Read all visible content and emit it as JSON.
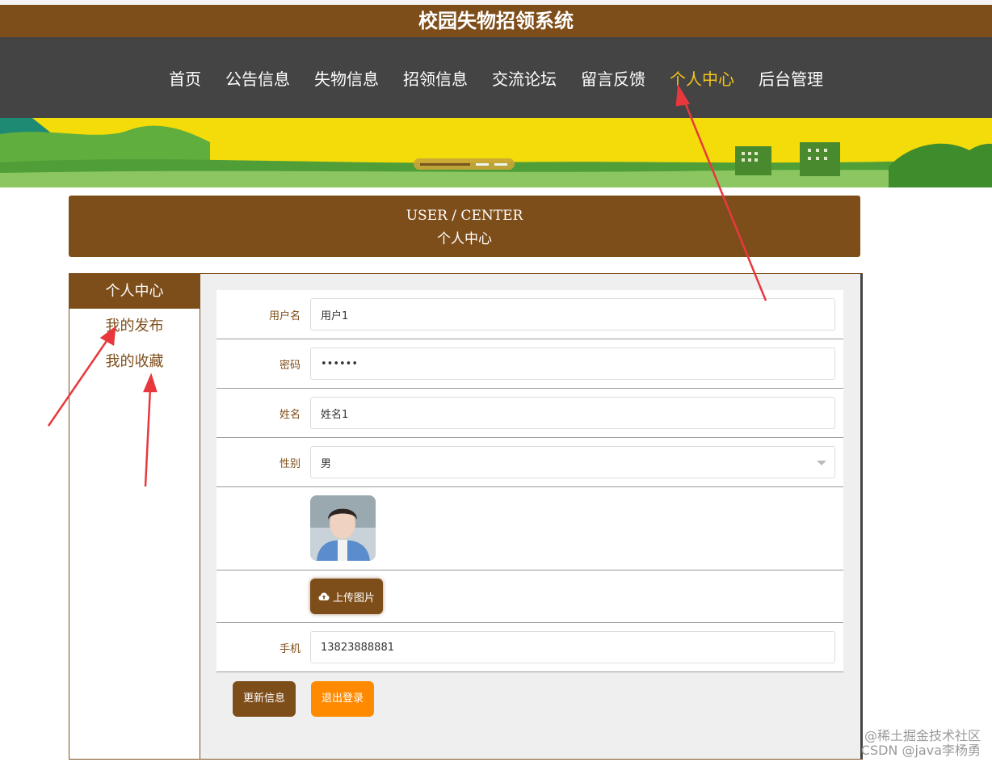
{
  "site": {
    "title": "校园失物招领系统"
  },
  "nav": {
    "items": [
      "首页",
      "公告信息",
      "失物信息",
      "招领信息",
      "交流论坛",
      "留言反馈",
      "个人中心",
      "后台管理"
    ],
    "active_index": 6,
    "active_color": "#f5c518"
  },
  "section": {
    "title_en": "USER / CENTER",
    "title_cn": "个人中心"
  },
  "sidebar": {
    "header": "个人中心",
    "items": [
      "我的发布",
      "我的收藏"
    ]
  },
  "form": {
    "username": {
      "label": "用户名",
      "value": "用户1"
    },
    "password": {
      "label": "密码",
      "value": "••••••"
    },
    "name": {
      "label": "姓名",
      "value": "姓名1"
    },
    "gender": {
      "label": "性别",
      "value": "男"
    },
    "upload": {
      "label": "上传图片"
    },
    "phone": {
      "label": "手机",
      "value": "13823888881"
    }
  },
  "buttons": {
    "update": "更新信息",
    "logout": "退出登录"
  },
  "watermark": {
    "line1": "@稀土掘金技术社区",
    "line2": "CSDN @java李杨勇"
  },
  "colors": {
    "brand": "#7e4e1a",
    "nav_bg": "#444444",
    "logout": "#ff8a00",
    "annotation_arrow": "#e8383d"
  },
  "icons": {
    "upload": "cloud-upload-icon",
    "select": "chevron-down-icon"
  }
}
